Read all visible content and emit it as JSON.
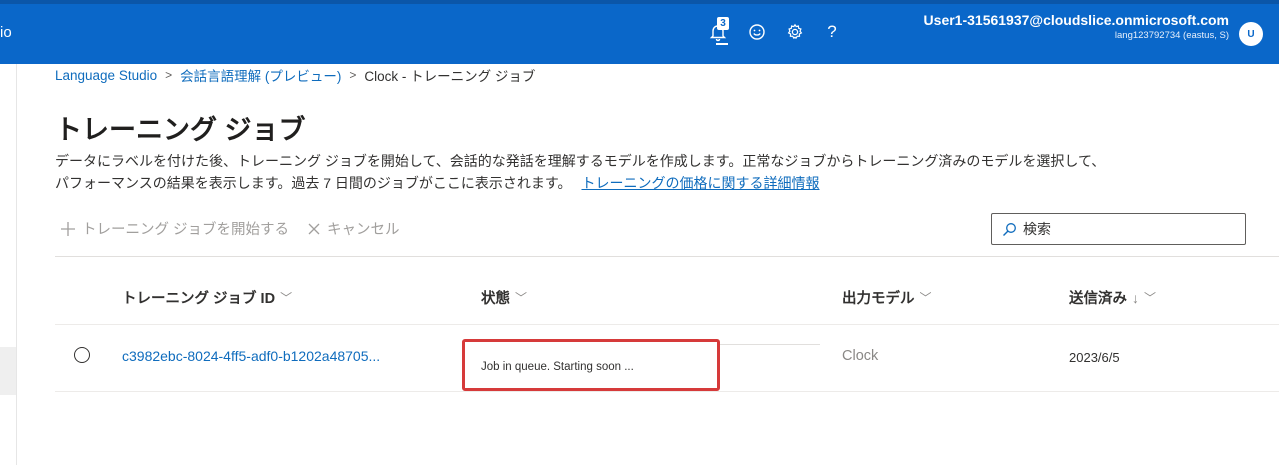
{
  "header": {
    "app_title_fragment": "io",
    "notification_count": "3",
    "help_glyph": "?",
    "user_email": "User1-31561937@cloudslice.onmicrosoft.com",
    "user_sub": "lang123792734 (eastus, S)",
    "avatar_initial": "U",
    "icons": [
      "notification-bell-icon",
      "smiley-feedback-icon",
      "gear-icon",
      "help-icon"
    ]
  },
  "breadcrumb": {
    "items": [
      "Language Studio",
      "会話言語理解 (プレビュー)",
      "Clock - トレーニング ジョブ"
    ],
    "separator": ">"
  },
  "page": {
    "title": "トレーニング ジョブ",
    "description_line1": "データにラベルを付けた後、トレーニング ジョブを開始して、会話的な発話を理解するモデルを作成します。正常なジョブからトレーニング済みのモデルを選択して、",
    "description_line2": "パフォーマンスの結果を表示します。過去 7 日間のジョブがここに表示されます。",
    "description_link": "トレーニングの価格に関する詳細情報"
  },
  "toolbar": {
    "start_label": "トレーニング ジョブを開始する",
    "cancel_label": "キャンセル",
    "search_placeholder": "検索"
  },
  "table": {
    "columns": [
      "トレーニング ジョブ ID",
      "状態",
      "出力モデル",
      "送信済み"
    ],
    "sort_arrow": "↓",
    "rows": [
      {
        "job_id": "c3982ebc-8024-4ff5-adf0-b1202a48705...",
        "status": "Job in queue. Starting soon ...",
        "model": "Clock",
        "submitted": "2023/6/5"
      }
    ]
  },
  "colors": {
    "header_bg": "#0a67c9",
    "link": "#0f6cbd",
    "highlight_border": "#d63a3a"
  }
}
